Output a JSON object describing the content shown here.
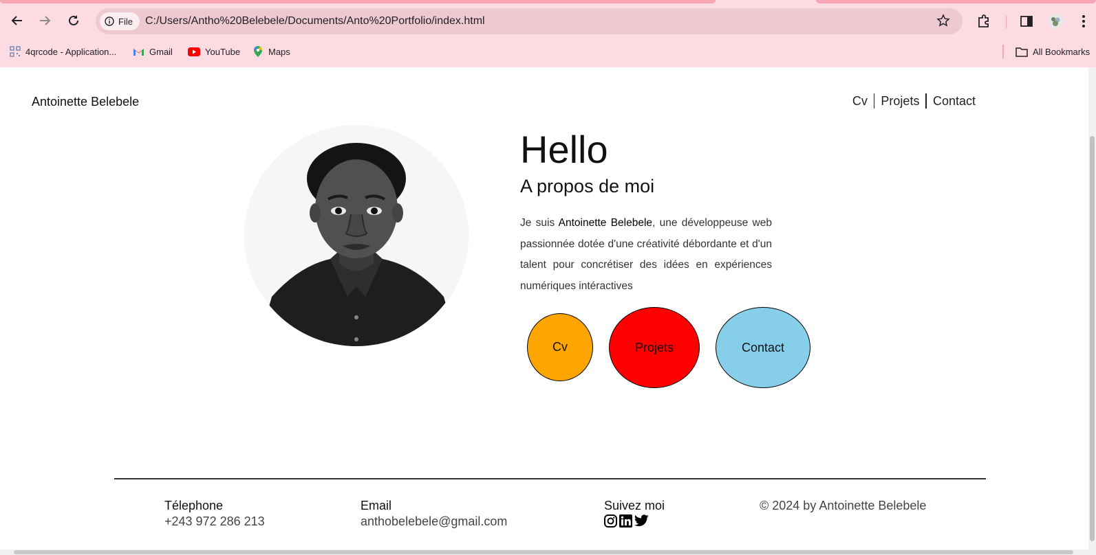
{
  "browser": {
    "site_chip_label": "File",
    "url": "C:/Users/Antho%20Belebele/Documents/Anto%20Portfolio/index.html",
    "icons": [
      "back-icon",
      "forward-icon",
      "reload-icon",
      "info-icon",
      "star-icon",
      "extensions-icon",
      "side-panel-icon",
      "profile-avatar",
      "more-icon"
    ],
    "bookmarks": [
      {
        "label": "4qrcode - Application...",
        "icon": "qr-icon"
      },
      {
        "label": "Gmail",
        "icon": "gmail-icon"
      },
      {
        "label": "YouTube",
        "icon": "youtube-icon"
      },
      {
        "label": "Maps",
        "icon": "maps-icon"
      }
    ],
    "all_bookmarks_label": "All Bookmarks",
    "chrome_color": "#fcdbe2"
  },
  "site": {
    "brand": "Antoinette Belebele",
    "nav": [
      "Cv",
      "Projets",
      "Contact"
    ]
  },
  "hero": {
    "title": "Hello",
    "subtitle": "A propos de moi",
    "bio_prefix": "Je suis ",
    "bio_name": "Antoinette Belebele",
    "bio_suffix": ", une développeuse web passionnée dotée d'une créativité débordante et d'un talent pour concrétiser des idées en expériences numériques intéractives",
    "buttons": [
      {
        "label": "Cv",
        "color": "#ffa500"
      },
      {
        "label": "Projets",
        "color": "#ff0000"
      },
      {
        "label": "Contact",
        "color": "#87ceeb"
      }
    ]
  },
  "footer": {
    "phone_label": "Télephone",
    "phone": "+243 972 286 213",
    "email_label": "Email",
    "email": "anthobelebele@gmail.com",
    "social_label": "Suivez moi",
    "social_icons": [
      "instagram-icon",
      "linkedin-icon",
      "twitter-icon"
    ],
    "copyright": "© 2024 by Antoinette Belebele"
  }
}
